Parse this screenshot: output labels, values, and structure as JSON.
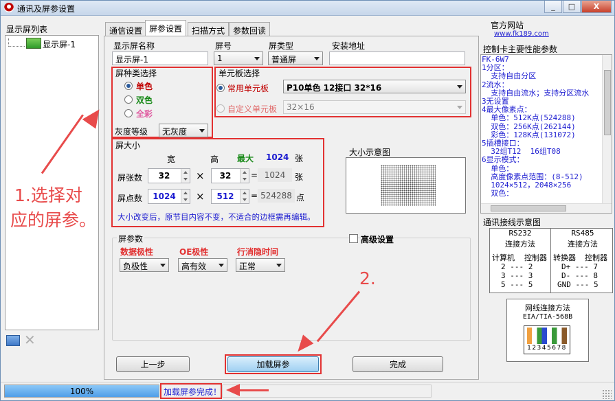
{
  "window": {
    "title": "通讯及屏参设置",
    "min": "_",
    "max": "□",
    "close": "X"
  },
  "sidebar": {
    "title": "显示屏列表",
    "items": [
      {
        "label": "显示屏-1"
      }
    ]
  },
  "tabs": [
    "通信设置",
    "屏参设置",
    "扫描方式",
    "参数回读"
  ],
  "screen": {
    "name_label": "显示屏名称",
    "name_value": "显示屏-1",
    "num_label": "屏号",
    "num_value": "1",
    "type_label": "屏类型",
    "type_value": "普通屏",
    "addr_label": "安装地址",
    "addr_value": ""
  },
  "color_group": {
    "title": "屏种类选择",
    "options": [
      "单色",
      "双色",
      "全彩"
    ],
    "gray_label": "灰度等级",
    "gray_value": "无灰度"
  },
  "unit_group": {
    "title": "单元板选择",
    "common_label": "常用单元板",
    "common_value": "P10单色 12接口 32*16",
    "custom_label": "自定义单元板",
    "custom_value": "32×16"
  },
  "size_group": {
    "title": "屏大小",
    "w_label": "宽",
    "h_label": "高",
    "max_label": "最大",
    "max_value": "1024",
    "max_unit": "张",
    "count_label": "屏张数",
    "count_w": "32",
    "count_h": "32",
    "count_total": "1024",
    "count_unit": "张",
    "dots_label": "屏点数",
    "dots_w": "1024",
    "dots_h": "512",
    "dots_total": "524288",
    "dots_unit": "点",
    "x1": "×",
    "x2": "×",
    "eq1": "=",
    "eq2": "=",
    "note": "大小改变后，原节目内容不变，不适合的边框需再编辑。",
    "preview_label": "大小示意图"
  },
  "param_group": {
    "title": "屏参数",
    "advanced_label": "高级设置",
    "data_label": "数据极性",
    "data_value": "负极性",
    "oe_label": "OE极性",
    "oe_value": "高有效",
    "row_label": "行消隐时间",
    "row_value": "正常"
  },
  "buttons": {
    "prev": "上一步",
    "load": "加载屏参",
    "done": "完成"
  },
  "status": {
    "progress": 100,
    "progress_label": "100%",
    "message": "加载屏参完成！"
  },
  "annotations": {
    "a1_line1": "1.选择对",
    "a1_line2": "应的屏参。",
    "a2": "2."
  },
  "right_panel": {
    "site_title": "官方网站",
    "site_url": "www.fk189.com",
    "perf_title": "控制卡主要性能参数",
    "perf_lines": [
      "FK-6W7",
      "1分区：",
      "  支持自由分区",
      "2流水：",
      "  支持自由流水；支持分区流水",
      "3无设置",
      "4最大像素点：",
      "  单色：512K点(524288)",
      "  双色：256K点(262144)",
      "  彩色：128K点(131072)",
      "5插槽接口：",
      "  32组T12  16组T08",
      "6显示模式：",
      "  单色：",
      "  高度像素点范围：(8-512)",
      "  1024×512，2048×256",
      "  双色："
    ],
    "wiring_title": "通讯接线示意图",
    "rs232": {
      "title": "RS232",
      "sub": "连接方法",
      "h1": "计算机",
      "h2": "控制器",
      "rows": [
        "2 --- 2",
        "3 --- 3",
        "5 --- 5"
      ]
    },
    "rs485": {
      "title": "RS485",
      "sub": "连接方法",
      "h1": "转换器",
      "h2": "控制器",
      "rows": [
        "D+ --- 7",
        "D- --- 8",
        "GND --- 5"
      ]
    },
    "net_title": "网线连接方法",
    "net_sub": "EIA/TIA-568B",
    "net_pins": "12345678"
  },
  "colors": {
    "annotation_red": "#e84b4b",
    "highlight_red": "#e23131",
    "mono_red": "#c00000",
    "dual_green": "#1a8a1a",
    "full_pink": "#e05aa0",
    "blue_text": "#1c1cd0",
    "progress_blue": "#4f9ee8"
  }
}
